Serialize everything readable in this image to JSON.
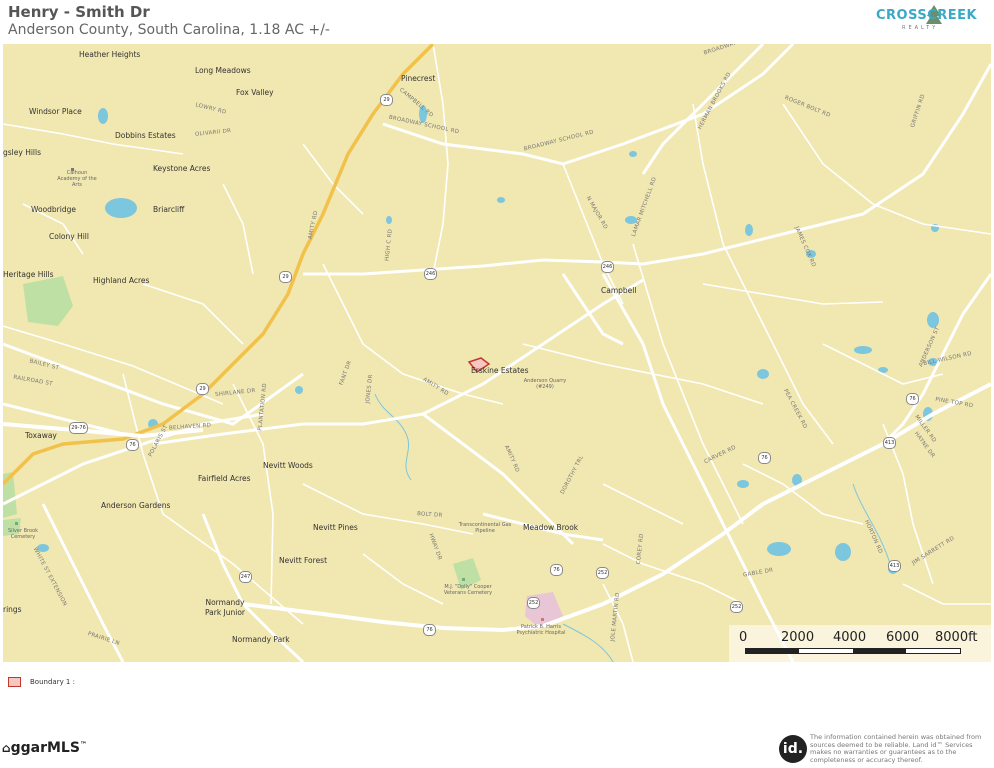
{
  "header": {
    "title": "Henry - Smith Dr",
    "subtitle": "Anderson County, South Carolina, 1.18 AC +/-"
  },
  "logo": {
    "text": "CROSSCREEK",
    "subtext": "REALTY"
  },
  "colors": {
    "land": "#f1e7b0",
    "road": "#ffffff",
    "highway": "#f1c14c",
    "water": "#7cc6de",
    "park": "#bfe0a4",
    "boundary": "#c0392b"
  },
  "map": {
    "places": [
      {
        "name": "Heather Heights"
      },
      {
        "name": "Long Meadows"
      },
      {
        "name": "Pinecrest"
      },
      {
        "name": "Fox Valley"
      },
      {
        "name": "Windsor Place"
      },
      {
        "name": "Dobbins Estates"
      },
      {
        "name": "gsley Hills"
      },
      {
        "name": "Keystone Acres"
      },
      {
        "name": "Woodbridge"
      },
      {
        "name": "Briarcliff"
      },
      {
        "name": "Colony Hill"
      },
      {
        "name": "Heritage Hills"
      },
      {
        "name": "Highland Acres"
      },
      {
        "name": "Campbell"
      },
      {
        "name": "Erskine Estates"
      },
      {
        "name": "Toxaway"
      },
      {
        "name": "Nevitt Woods"
      },
      {
        "name": "Fairfield Acres"
      },
      {
        "name": "Anderson Gardens"
      },
      {
        "name": "Nevitt Pines"
      },
      {
        "name": "Meadow Brook"
      },
      {
        "name": "Nevitt Forest"
      },
      {
        "name": "Normandy Park Junior"
      },
      {
        "name": "Normandy Park"
      },
      {
        "name": "rings"
      }
    ],
    "roads": [
      {
        "name": "BROADWAY ST"
      },
      {
        "name": "BROADWAY SCHOOL RD"
      },
      {
        "name": "BROADWAY SCHOOL RD"
      },
      {
        "name": "HERMAN BROOKS RD"
      },
      {
        "name": "ROGER BOLT RD"
      },
      {
        "name": "GRIFFIN RD"
      },
      {
        "name": "AMITY RD"
      },
      {
        "name": "N MAJOR RD"
      },
      {
        "name": "LAMAR MITCHELL RD"
      },
      {
        "name": "JAMES COX RD"
      },
      {
        "name": "ANDERSON ST"
      },
      {
        "name": "BILL WILSON RD"
      },
      {
        "name": "PEA CREEK RD"
      },
      {
        "name": "PINE TOP RD"
      },
      {
        "name": "AMITY RD"
      },
      {
        "name": "AMITY RD"
      },
      {
        "name": "DOROTHY TRL"
      },
      {
        "name": "CARVER RD"
      },
      {
        "name": "BELHAVEN RD"
      },
      {
        "name": "PLANTATION RD"
      },
      {
        "name": "SHIRLANE DR"
      },
      {
        "name": "POLARIS ST"
      },
      {
        "name": "BOLT DR"
      },
      {
        "name": "HWAY DR"
      },
      {
        "name": "HORTON RD"
      },
      {
        "name": "JIM SARRETT RD"
      },
      {
        "name": "GABLE DR"
      },
      {
        "name": "WHITE ST EXTENSION"
      },
      {
        "name": "BAILEY ST"
      },
      {
        "name": "RAILROAD ST"
      },
      {
        "name": "CAMPBELL RD"
      },
      {
        "name": "LOWRY RD"
      },
      {
        "name": "OLIVARII DR"
      },
      {
        "name": "HIGH C RD"
      },
      {
        "name": "FANT DR"
      },
      {
        "name": "JONES DR"
      },
      {
        "name": "MILLER RD"
      },
      {
        "name": "HAYNE DR"
      },
      {
        "name": "JOLE MARTIN RD"
      },
      {
        "name": "COREY RD"
      },
      {
        "name": "PRAIRIE LN"
      }
    ],
    "shields": [
      {
        "num": "29"
      },
      {
        "num": "29"
      },
      {
        "num": "29"
      },
      {
        "num": "246"
      },
      {
        "num": "246"
      },
      {
        "num": "76"
      },
      {
        "num": "76"
      },
      {
        "num": "76"
      },
      {
        "num": "76"
      },
      {
        "num": "76"
      },
      {
        "num": "413"
      },
      {
        "num": "413"
      },
      {
        "num": "252"
      },
      {
        "num": "252"
      },
      {
        "num": "252"
      },
      {
        "num": "247"
      },
      {
        "num": "29-76"
      }
    ],
    "pois": [
      {
        "name": "Calhoun Academy of the Arts"
      },
      {
        "name": "Anderson Quarry (#249)"
      },
      {
        "name": "Transcontinental Gas Pipeline"
      },
      {
        "name": "M.J. \"Dolly\" Cooper Veterans Cemetery"
      },
      {
        "name": "Patrick B. Harris Psychiatric Hospital"
      },
      {
        "name": "Silver Brook Cemetery"
      }
    ]
  },
  "scale": {
    "labels": [
      "0",
      "2000",
      "4000",
      "6000",
      "8000ft"
    ]
  },
  "legend": {
    "label": "Boundary 1 :"
  },
  "footer": {
    "mls_text": "ggarMLS",
    "id_logo": "id.",
    "disclaimer": "The information contained herein was obtained from sources deemed to be reliable. Land id™ Services makes no warranties or guarantees as to the completeness or accuracy thereof."
  }
}
